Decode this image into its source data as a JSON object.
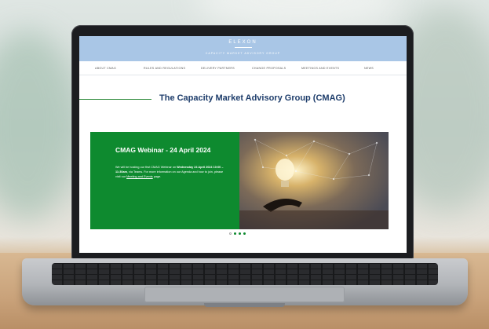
{
  "site": {
    "logo": "ELEXON",
    "tagline": "CAPACITY MARKET ADVISORY GROUP"
  },
  "nav": {
    "items": [
      {
        "label": "ABOUT CMAG"
      },
      {
        "label": "RULES AND REGULATIONS"
      },
      {
        "label": "DELIVERY PARTNERS"
      },
      {
        "label": "CHANGE PROPOSALS"
      },
      {
        "label": "MEETINGS AND EVENTS"
      },
      {
        "label": "NEWS"
      }
    ]
  },
  "page": {
    "title": "The Capacity Market Advisory Group (CMAG)"
  },
  "banner": {
    "heading": "CMAG Webinar - 24 April 2024",
    "body_intro": "We will be hosting our first CMAG Webinar on ",
    "body_date": "Wednesday 24 April 2024 10:00 – 11:30am",
    "body_mid": ", via Teams. For more information on our Agenda and how to join, please visit our ",
    "body_link": "Meeting and Events",
    "body_end": " page."
  },
  "carousel": {
    "active_index": 1,
    "count": 4
  },
  "colors": {
    "header_bg": "#a9c6e6",
    "brand_green": "#0e8a2f",
    "title_blue": "#1e3d6b"
  }
}
